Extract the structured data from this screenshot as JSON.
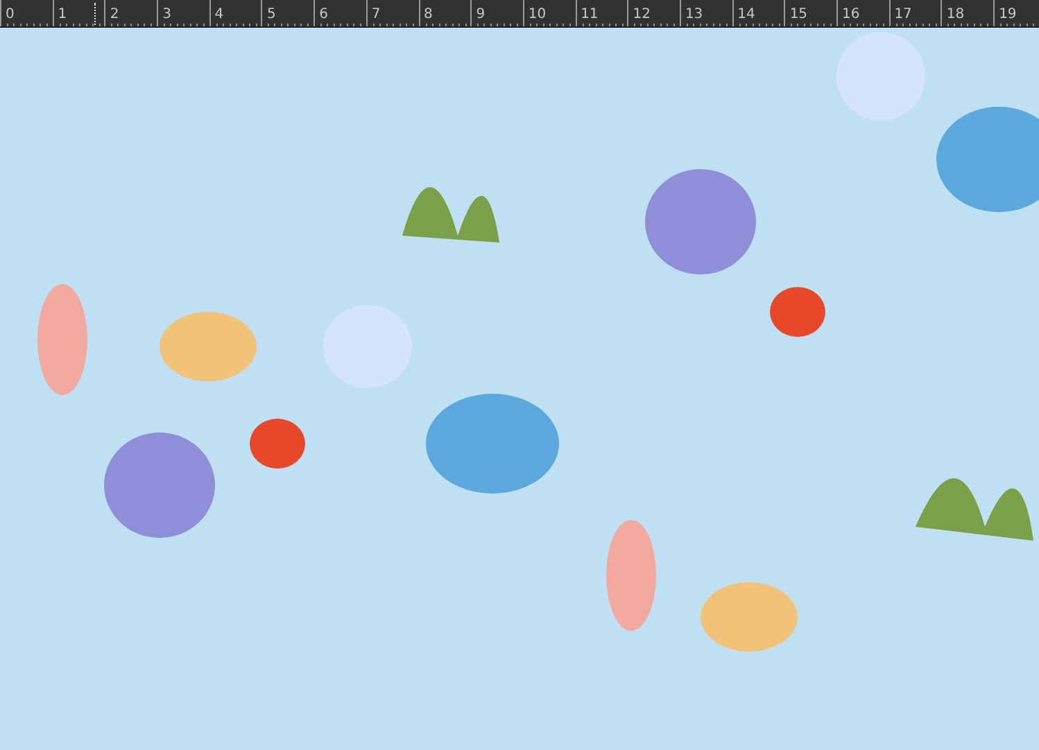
{
  "ruler": {
    "labels": [
      "0",
      "1",
      "2",
      "3",
      "4",
      "5",
      "6",
      "7",
      "8",
      "9",
      "10",
      "11",
      "12",
      "13",
      "14",
      "15",
      "16",
      "17",
      "18",
      "19"
    ]
  }
}
